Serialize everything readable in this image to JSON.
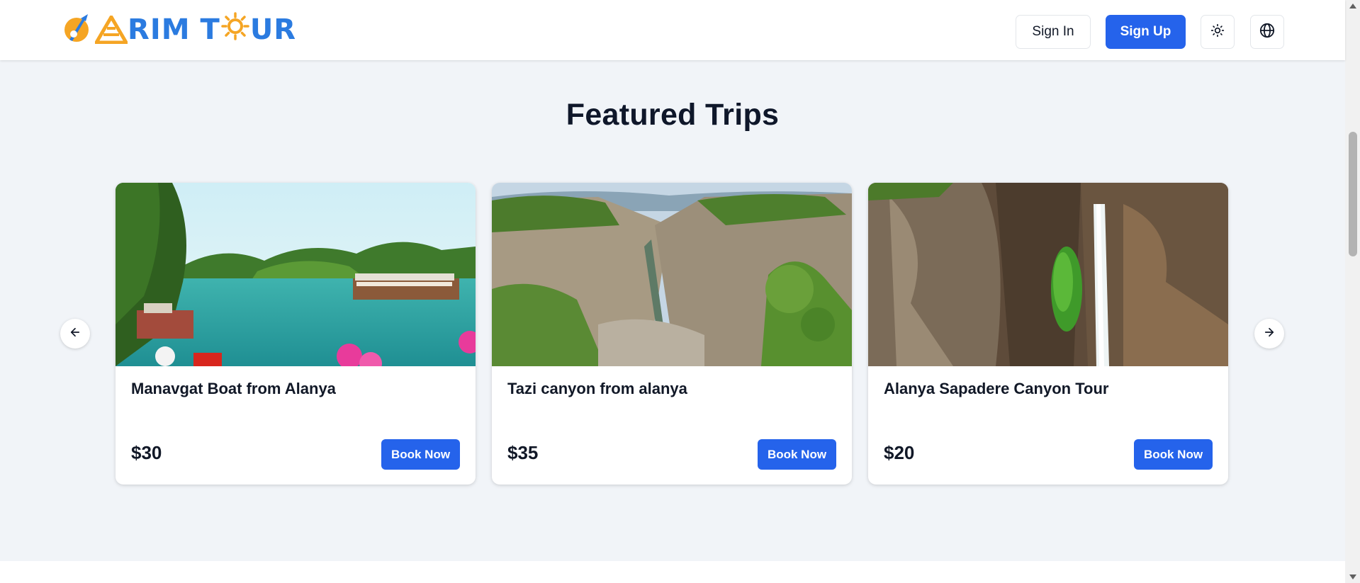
{
  "header": {
    "logo_text": "ARIM T UR",
    "logo_parts": [
      "A",
      "R",
      "I",
      "M",
      "T",
      "U",
      "R"
    ],
    "signin_label": "Sign In",
    "signup_label": "Sign Up",
    "theme_icon": "sun-icon",
    "language_icon": "globe-icon"
  },
  "section": {
    "title": "Featured Trips"
  },
  "trips": [
    {
      "title": "Manavgat Boat from Alanya",
      "price": "$30",
      "button": "Book Now",
      "image": "river-with-boats"
    },
    {
      "title": "Tazi canyon from alanya",
      "price": "$35",
      "button": "Book Now",
      "image": "canyon-cliffs"
    },
    {
      "title": "Alanya Sapadere Canyon Tour",
      "price": "$20",
      "button": "Book Now",
      "image": "waterfall-canyon"
    }
  ],
  "carousel": {
    "prev_icon": "arrow-left-icon",
    "next_icon": "arrow-right-icon"
  },
  "colors": {
    "primary": "#2563eb",
    "page_background": "#f1f4f8",
    "logo_blue": "#2b7be0",
    "logo_orange": "#f5a524"
  }
}
